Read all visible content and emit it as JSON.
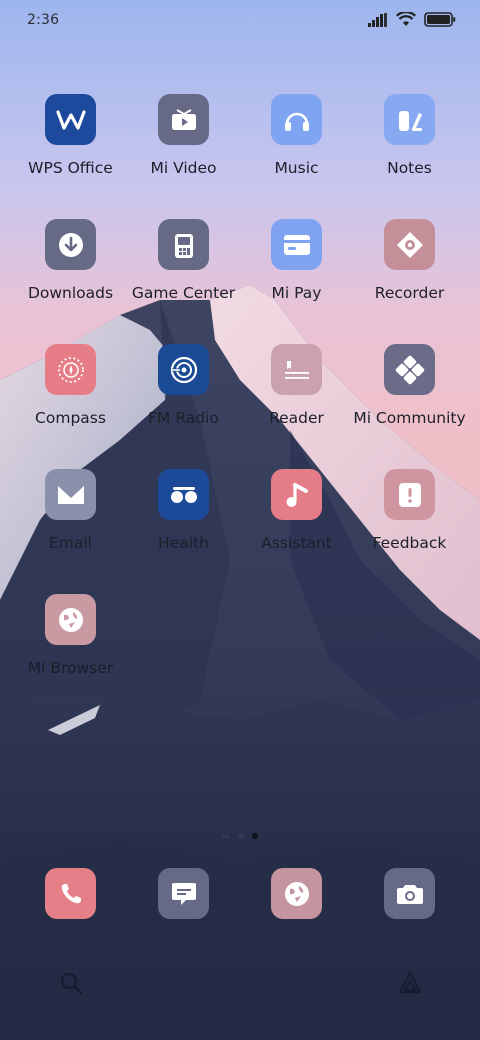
{
  "status_bar": {
    "time": "2:36"
  },
  "apps": [
    {
      "label": "WPS Office",
      "icon": "wps-icon",
      "color": "#1d4a9c"
    },
    {
      "label": "Mi Video",
      "icon": "video-icon",
      "color": "#666a86"
    },
    {
      "label": "Music",
      "icon": "headphones-icon",
      "color": "#7fa4f1"
    },
    {
      "label": "Notes",
      "icon": "notes-icon",
      "color": "#86a9f2"
    },
    {
      "label": "Downloads",
      "icon": "download-icon",
      "color": "#666a84"
    },
    {
      "label": "Game Center",
      "icon": "game-icon",
      "color": "#676a84"
    },
    {
      "label": "Mi Pay",
      "icon": "wallet-icon",
      "color": "#7fa3f0"
    },
    {
      "label": "Recorder",
      "icon": "recorder-icon",
      "color": "#c48f98"
    },
    {
      "label": "Compass",
      "icon": "compass-icon",
      "color": "#e67d86"
    },
    {
      "label": "FM Radio",
      "icon": "radio-icon",
      "color": "#1b4a95"
    },
    {
      "label": "Reader",
      "icon": "reader-icon",
      "color": "#c9a2ad"
    },
    {
      "label": "Mi Community",
      "icon": "community-icon",
      "color": "#6b6c87"
    },
    {
      "label": "Email",
      "icon": "email-icon",
      "color": "#8b90aa"
    },
    {
      "label": "Health",
      "icon": "health-icon",
      "color": "#1c4a98"
    },
    {
      "label": "Assistant",
      "icon": "assistant-icon",
      "color": "#e57d88"
    },
    {
      "label": "Feedback",
      "icon": "feedback-icon",
      "color": "#cf96a1"
    },
    {
      "label": "Mi Browser",
      "icon": "browser-icon",
      "color": "#c99aa2"
    }
  ],
  "dock": [
    {
      "name": "phone",
      "icon": "phone-icon",
      "color": "#e57f88"
    },
    {
      "name": "messages",
      "icon": "message-icon",
      "color": "#676a86"
    },
    {
      "name": "browser",
      "icon": "browser-icon",
      "color": "#c4959e"
    },
    {
      "name": "camera",
      "icon": "camera-icon",
      "color": "#676a86"
    }
  ],
  "pages": {
    "count": 3,
    "active": 2
  }
}
